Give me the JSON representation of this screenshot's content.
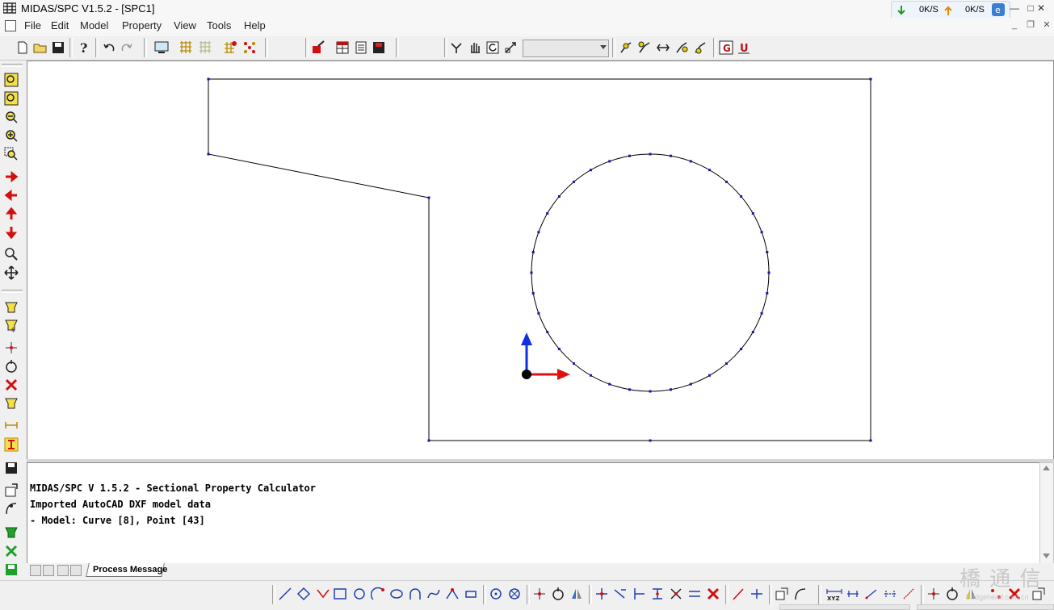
{
  "window": {
    "title": "MIDAS/SPC V1.5.2 - [SPC1]",
    "controls": {
      "minimize": "—",
      "maximize": "□",
      "close": "✕"
    },
    "mdi_controls": {
      "minimize": "_",
      "restore": "❐",
      "close": "✕"
    }
  },
  "netspeed": {
    "down": "0K/S",
    "up": "0K/S"
  },
  "menu": [
    "File",
    "Edit",
    "Model",
    "Property",
    "View",
    "Tools",
    "Help"
  ],
  "toolbar": {
    "combo_value": ""
  },
  "messages": {
    "lines": [
      "MIDAS/SPC V 1.5.2 - Sectional Property Calculator",
      "Imported AutoCAD DXF model data",
      "- Model: Curve [8], Point [43]"
    ],
    "tab_label": "Process Message"
  },
  "watermark": {
    "text": "橋 通 信",
    "sub": "Bridgehead.com.cn"
  },
  "colors": {
    "curve": "#000000",
    "point": "#1515b0",
    "axis_x": "#e01010",
    "axis_y": "#1030e0"
  }
}
